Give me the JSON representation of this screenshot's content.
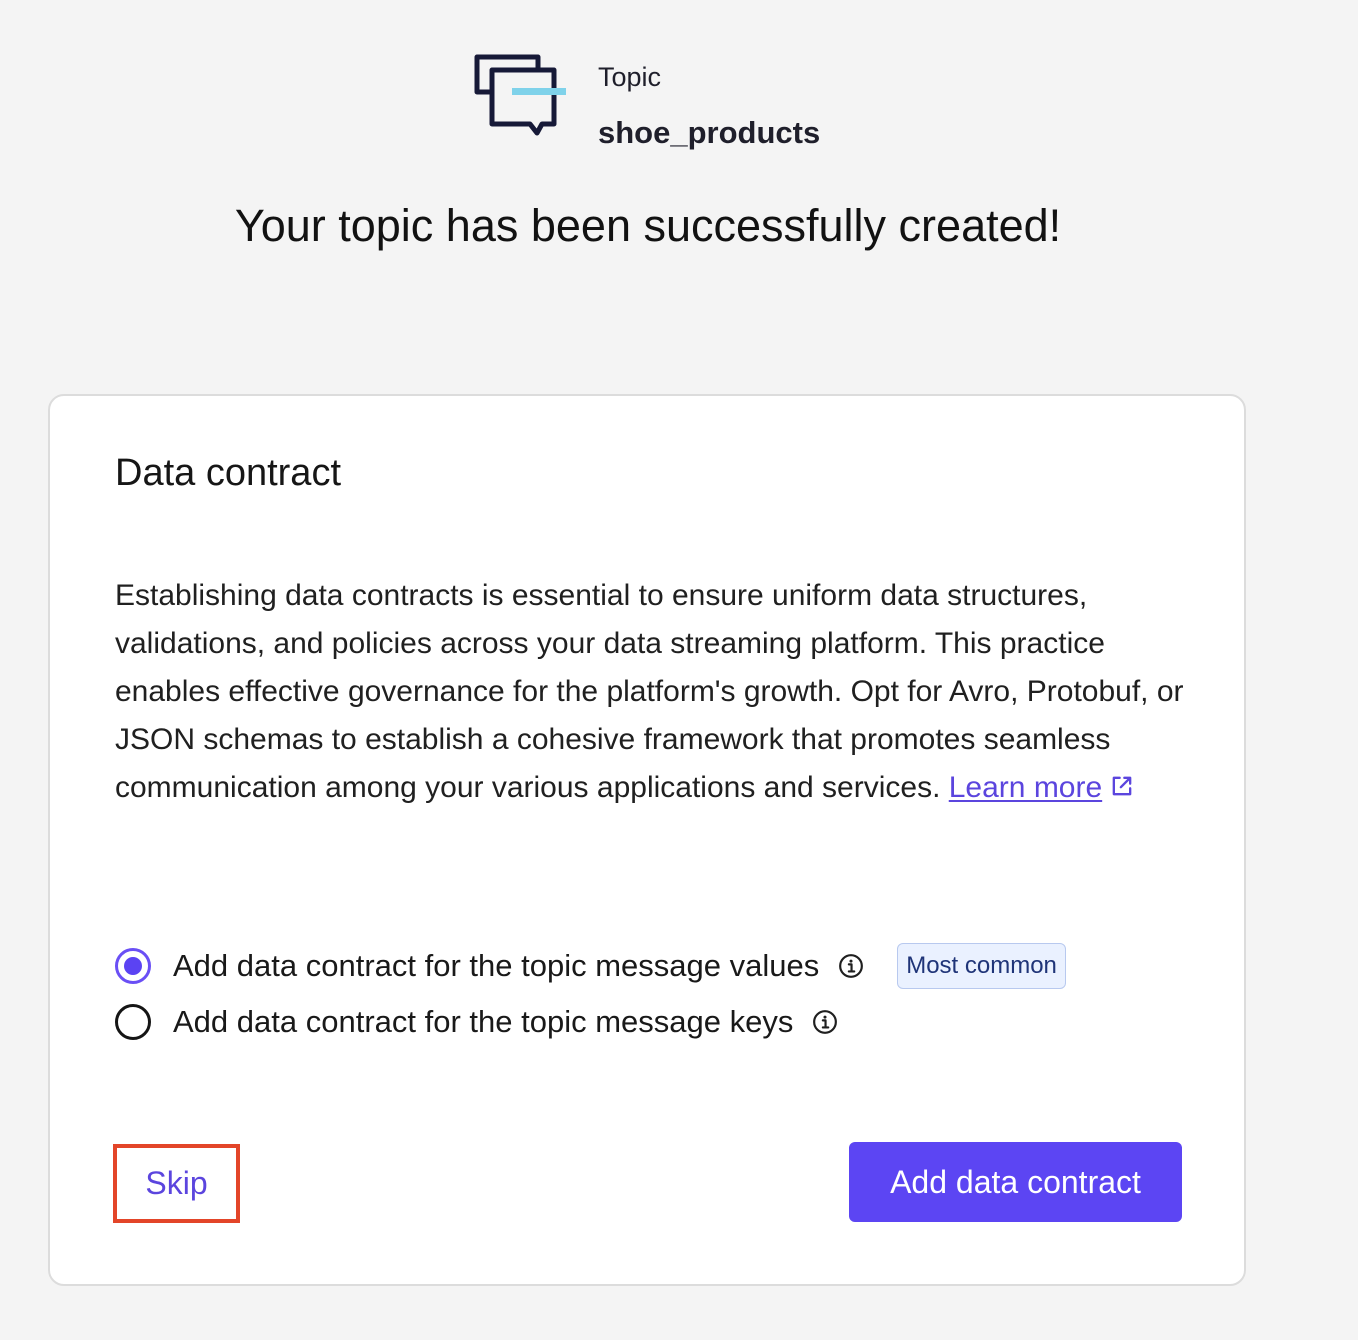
{
  "header": {
    "icon": "chat-topic-icon",
    "kind_label": "Topic",
    "topic_name": "shoe_products",
    "success_message": "Your topic has been successfully created!"
  },
  "card": {
    "title": "Data contract",
    "description": "Establishing data contracts is essential to ensure uniform data structures, validations, and policies across your data streaming platform. This practice enables effective governance for the platform's growth. Opt for Avro, Protobuf, or JSON schemas to establish a cohesive framework that promotes seamless communication among your various applications and services.",
    "learn_more": "Learn more",
    "learn_more_icon": "external-link-icon",
    "options": [
      {
        "label": "Add data contract for the topic message values",
        "selected": true,
        "info_icon": "info-icon",
        "badge": "Most common"
      },
      {
        "label": "Add data contract for the topic message keys",
        "selected": false,
        "info_icon": "info-icon"
      }
    ],
    "skip_label": "Skip",
    "primary_label": "Add data contract"
  },
  "colors": {
    "background": "#f4f4f4",
    "accent": "#5c45f3",
    "link": "#5b45de",
    "highlight_border": "#e34529",
    "badge_background": "#eaf1ff"
  }
}
